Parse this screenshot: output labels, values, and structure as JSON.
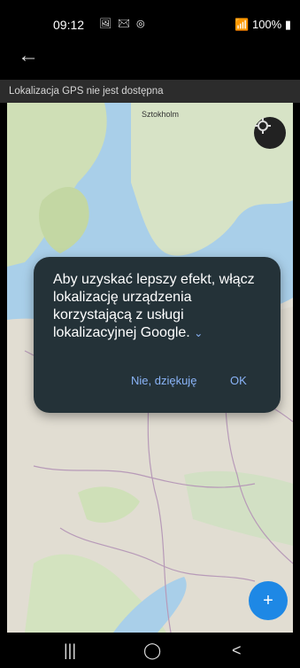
{
  "status": {
    "time": "09:12",
    "left_icons": "🖼 ✉ ◎",
    "right_text": "100%"
  },
  "app": {
    "back_label": "←",
    "gps_banner": "Lokalizacja GPS nie jest dostępna"
  },
  "map": {
    "city_label": "Sztokholm"
  },
  "dialog": {
    "message": "Aby uzyskać lepszy efekt, włącz lokalizację urządzenia korzystającą z usługi lokalizacyjnej Google.",
    "chevron": "⌄",
    "decline_button": "Nie, dziękuję",
    "ok_button": "OK"
  },
  "fab": {
    "label": "+"
  },
  "nav": {
    "recents": "|||",
    "home": "◯",
    "back": "<"
  }
}
